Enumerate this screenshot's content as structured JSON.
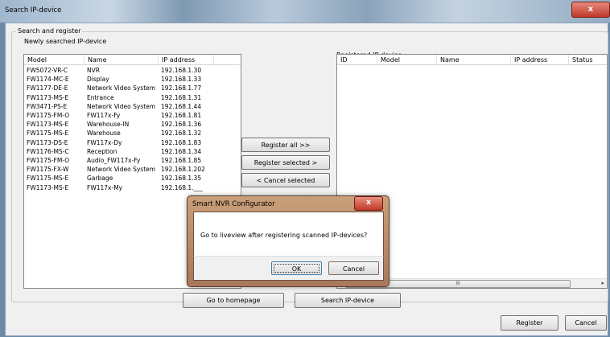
{
  "window": {
    "title": "Search IP-device",
    "close_glyph": "x"
  },
  "group_title": "Search and register",
  "left_panel": {
    "label": "Newly searched IP-device",
    "columns": [
      "Model",
      "Name",
      "IP address"
    ],
    "rows": [
      {
        "model": "FW5072-VR-C",
        "name": "NVR",
        "ip": "192.168.1.30"
      },
      {
        "model": "FW1174-MC-E",
        "name": "Display",
        "ip": "192.168.1.33"
      },
      {
        "model": "FW1177-DE-E",
        "name": "Network Video System",
        "ip": "192.168.1.77"
      },
      {
        "model": "FW1173-MS-E",
        "name": "Entrance",
        "ip": "192.168.1.31"
      },
      {
        "model": "FW3471-PS-E",
        "name": "Network Video System",
        "ip": "192.168.1.44"
      },
      {
        "model": "FW1175-FM-O",
        "name": "FW117x-Fy",
        "ip": "192.168.1.81"
      },
      {
        "model": "FW1173-MS-E",
        "name": "Warehouse-IN",
        "ip": "192.168.1.36"
      },
      {
        "model": "FW1175-MS-E",
        "name": "Warehouse",
        "ip": "192.168.1.32"
      },
      {
        "model": "FW1173-DS-E",
        "name": "FW117x-Dy",
        "ip": "192.168.1.83"
      },
      {
        "model": "FW1176-MS-C",
        "name": "Reception",
        "ip": "192.168.1.34"
      },
      {
        "model": "FW1175-FM-O",
        "name": "Audio_FW117x-Fy",
        "ip": "192.168.1.85"
      },
      {
        "model": "FW1175-FX-W",
        "name": "Network Video System",
        "ip": "192.168.1.202"
      },
      {
        "model": "FW1175-MS-E",
        "name": "Garbage",
        "ip": "192.168.1.35"
      },
      {
        "model": "FW1173-MS-E",
        "name": "FW117x-My",
        "ip": "192.168.1.___"
      }
    ]
  },
  "right_panel": {
    "label": "Registered IP-device",
    "columns": [
      "ID",
      "Model",
      "Name",
      "IP address",
      "Status"
    ],
    "scroll_grip": "III",
    "scroll_arrow": "▸"
  },
  "buttons": {
    "register_all": "Register all >>",
    "register_selected": "Register selected >",
    "cancel_selected": "< Cancel selected",
    "go_homepage": "Go to homepage",
    "search": "Search IP-device",
    "register": "Register",
    "cancel": "Cancel"
  },
  "dialog": {
    "title": "Smart NVR Configurator",
    "close_glyph": "x",
    "message": "Go to liveview after registering scanned IP-devices?",
    "ok": "OK",
    "cancel": "Cancel"
  }
}
